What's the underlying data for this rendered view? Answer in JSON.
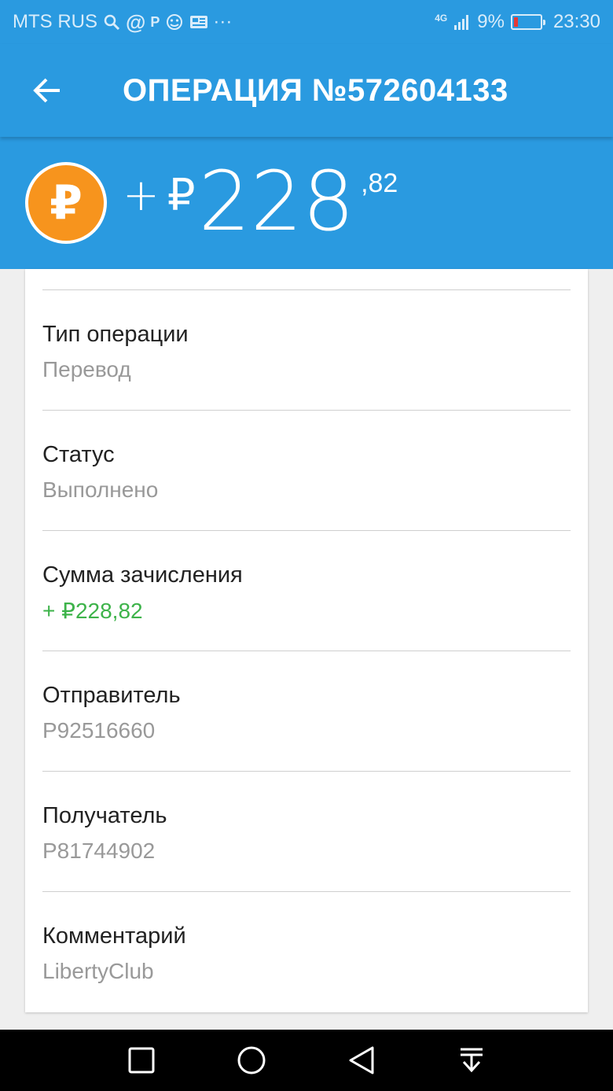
{
  "status_bar": {
    "carrier": "MTS RUS",
    "network": "4G",
    "battery": "9%",
    "time": "23:30",
    "notification_icons": [
      "search-icon",
      "at-icon",
      "p-icon",
      "mascot-icon",
      "news-icon",
      "more-dots-icon"
    ]
  },
  "app_bar": {
    "title": "ОПЕРАЦИЯ №572604133",
    "back_icon": "arrow-back-icon"
  },
  "amount": {
    "sign": "+",
    "currency": "₽",
    "integer": "228",
    "fraction": ",82",
    "coin_symbol": "₽",
    "coin_color": "#f7941d"
  },
  "details": [
    {
      "label": "Тип операции",
      "value": "Перевод"
    },
    {
      "label": "Статус",
      "value": "Выполнено"
    },
    {
      "label": "Сумма зачисления",
      "value": "+ ₽228,82"
    },
    {
      "label": "Отправитель",
      "value": "P92516660"
    },
    {
      "label": "Получатель",
      "value": "P81744902"
    },
    {
      "label": "Комментарий",
      "value": "LibertyClub"
    }
  ],
  "colors": {
    "primary": "#2a9ae0",
    "positive": "#3db34a"
  },
  "nav_bar": [
    "square-icon",
    "circle-icon",
    "triangle-back-icon",
    "download-arrow-icon"
  ]
}
